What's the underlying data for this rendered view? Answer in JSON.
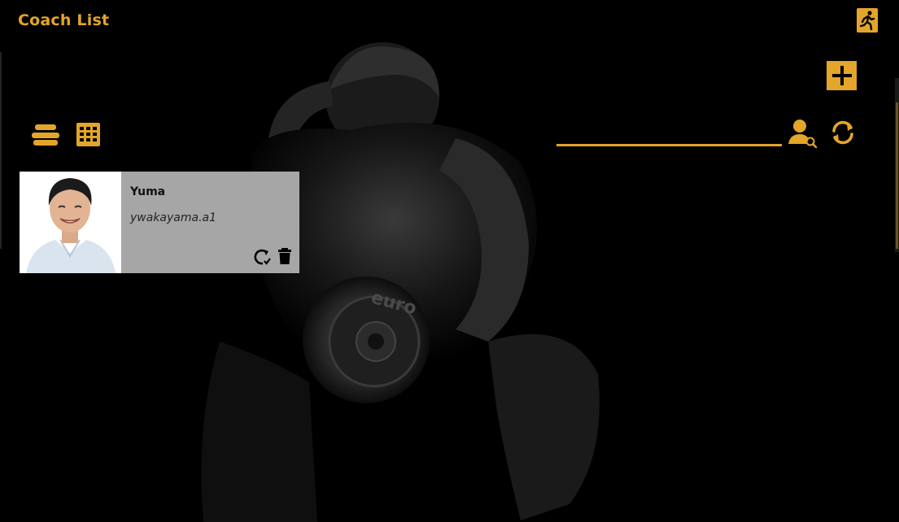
{
  "header": {
    "title": "Coach List"
  },
  "search": {
    "value": "",
    "placeholder": ""
  },
  "coaches": [
    {
      "name": "Yuma",
      "username": "ywakayama.a1"
    }
  ],
  "background": {
    "plate_text": "euro"
  },
  "colors": {
    "accent": "#e3a52a",
    "card_bg": "#a6a6a6",
    "page_bg": "#000000"
  },
  "icons": {
    "exit": "running-exit-icon",
    "add": "plus-icon",
    "view_list": "list-view-icon",
    "view_grid": "grid-view-icon",
    "search_user": "search-user-icon",
    "refresh": "refresh-icon",
    "reset_password": "reset-icon",
    "delete": "trash-icon"
  }
}
